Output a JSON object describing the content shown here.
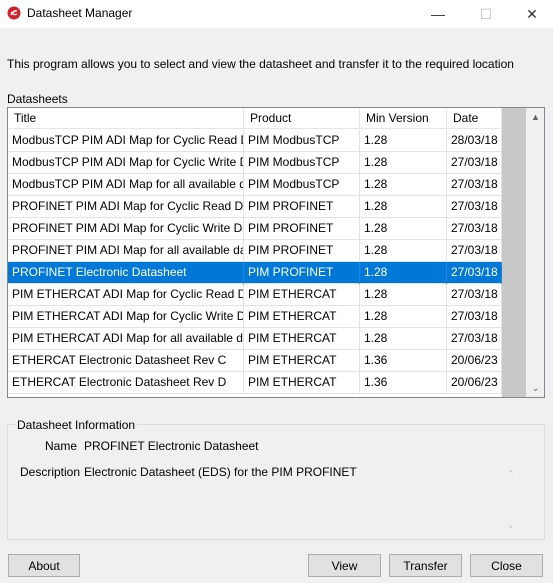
{
  "window": {
    "title": "Datasheet Manager",
    "icon": "red-app-logo-icon",
    "controls": {
      "minimize": "—",
      "maximize": "☐",
      "close": "✕"
    }
  },
  "intro_text": "This program allows you to select and view the datasheet and transfer it to the required location",
  "datasheets": {
    "label": "Datasheets",
    "columns": [
      "Title",
      "Product",
      "Min Version",
      "Date"
    ],
    "rows": [
      {
        "title": "ModbusTCP PIM ADI Map for Cyclic Read Data",
        "product": "PIM ModbusTCP",
        "min_version": "1.28",
        "date": "28/03/18"
      },
      {
        "title": "ModbusTCP PIM ADI Map for Cyclic Write Data",
        "product": "PIM ModbusTCP",
        "min_version": "1.28",
        "date": "27/03/18"
      },
      {
        "title": "ModbusTCP PIM ADI Map for all available data",
        "product": "PIM ModbusTCP",
        "min_version": "1.28",
        "date": "27/03/18"
      },
      {
        "title": "PROFINET PIM ADI Map for Cyclic Read Data",
        "product": "PIM PROFINET",
        "min_version": "1.28",
        "date": "27/03/18"
      },
      {
        "title": "PROFINET PIM ADI Map for Cyclic Write Data",
        "product": "PIM PROFINET",
        "min_version": "1.28",
        "date": "27/03/18"
      },
      {
        "title": "PROFINET PIM ADI Map for all available data",
        "product": "PIM PROFINET",
        "min_version": "1.28",
        "date": "27/03/18"
      },
      {
        "title": "PROFINET Electronic Datasheet",
        "product": "PIM PROFINET",
        "min_version": "1.28",
        "date": "27/03/18",
        "selected": true
      },
      {
        "title": "PIM ETHERCAT ADI Map for Cyclic Read Data",
        "product": "PIM ETHERCAT",
        "min_version": "1.28",
        "date": "27/03/18"
      },
      {
        "title": "PIM ETHERCAT ADI Map for Cyclic Write Data",
        "product": "PIM ETHERCAT",
        "min_version": "1.28",
        "date": "27/03/18"
      },
      {
        "title": "PIM ETHERCAT ADI Map for all available data",
        "product": "PIM ETHERCAT",
        "min_version": "1.28",
        "date": "27/03/18"
      },
      {
        "title": "ETHERCAT Electronic Datasheet Rev C",
        "product": "PIM ETHERCAT",
        "min_version": "1.36",
        "date": "20/06/23"
      },
      {
        "title": "ETHERCAT Electronic Datasheet Rev D",
        "product": "PIM ETHERCAT",
        "min_version": "1.36",
        "date": "20/06/23"
      }
    ]
  },
  "info": {
    "group_title": "Datasheet Information",
    "name_label": "Name",
    "name_value": "PROFINET Electronic Datasheet",
    "description_label": "Description",
    "description_value": "Electronic Datasheet (EDS) for the PIM PROFINET"
  },
  "buttons": {
    "about": "About",
    "view": "View",
    "transfer": "Transfer",
    "close": "Close"
  },
  "colors": {
    "selection": "#0078d7",
    "window_bg": "#f0f0f0"
  }
}
